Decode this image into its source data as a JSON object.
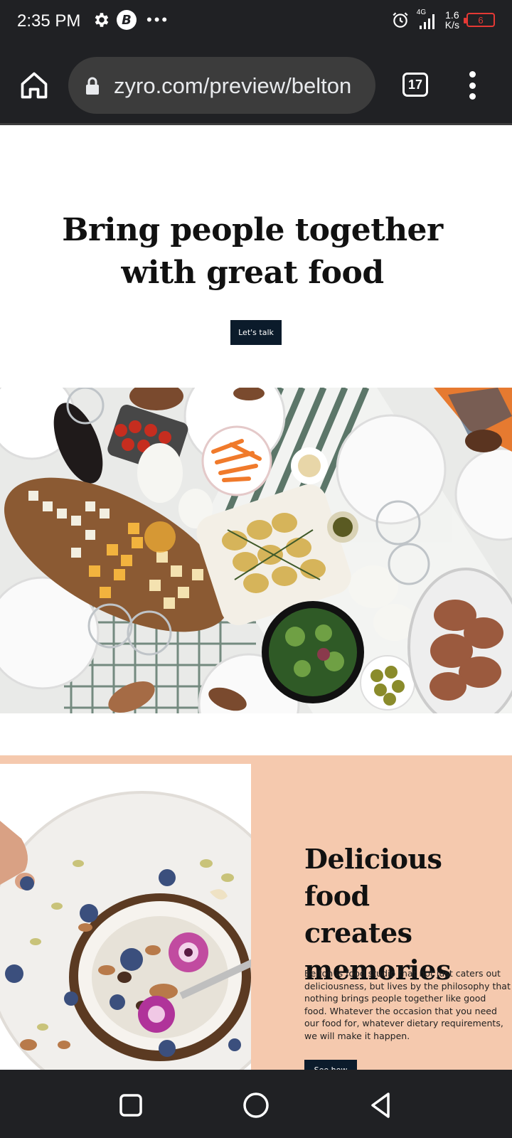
{
  "status_bar": {
    "time": "2:35 PM",
    "b_badge": "B",
    "more": "•••",
    "network": "4G",
    "speed_value": "1.6",
    "speed_unit": "K/s",
    "battery": "6",
    "battery_color": "#e53935"
  },
  "toolbar": {
    "url": "zyro.com/preview/belton",
    "tab_count": "17"
  },
  "hero": {
    "title_line1": "Bring people together",
    "title_line2": "with great food",
    "cta_label": "Let's talk"
  },
  "promo": {
    "title_line1": "Delicious food",
    "title_line2": "creates",
    "title_line3": "memories",
    "body": "Belton is food studio that not just caters out deliciousness, but lives by the philosophy that nothing brings people together like good food. Whatever the occasion that you need our food for, whatever dietary requirements, we will make it happen.",
    "cta_label": "See how"
  },
  "colors": {
    "dark_bar": "#202124",
    "navy_button": "#0b1b2b",
    "peach": "#f5c9ae"
  },
  "icons": [
    "gear-icon",
    "home-icon",
    "lock-icon",
    "menu-icon",
    "square-nav-icon",
    "circle-nav-icon",
    "back-nav-icon",
    "alarm-icon",
    "signal-icon"
  ]
}
